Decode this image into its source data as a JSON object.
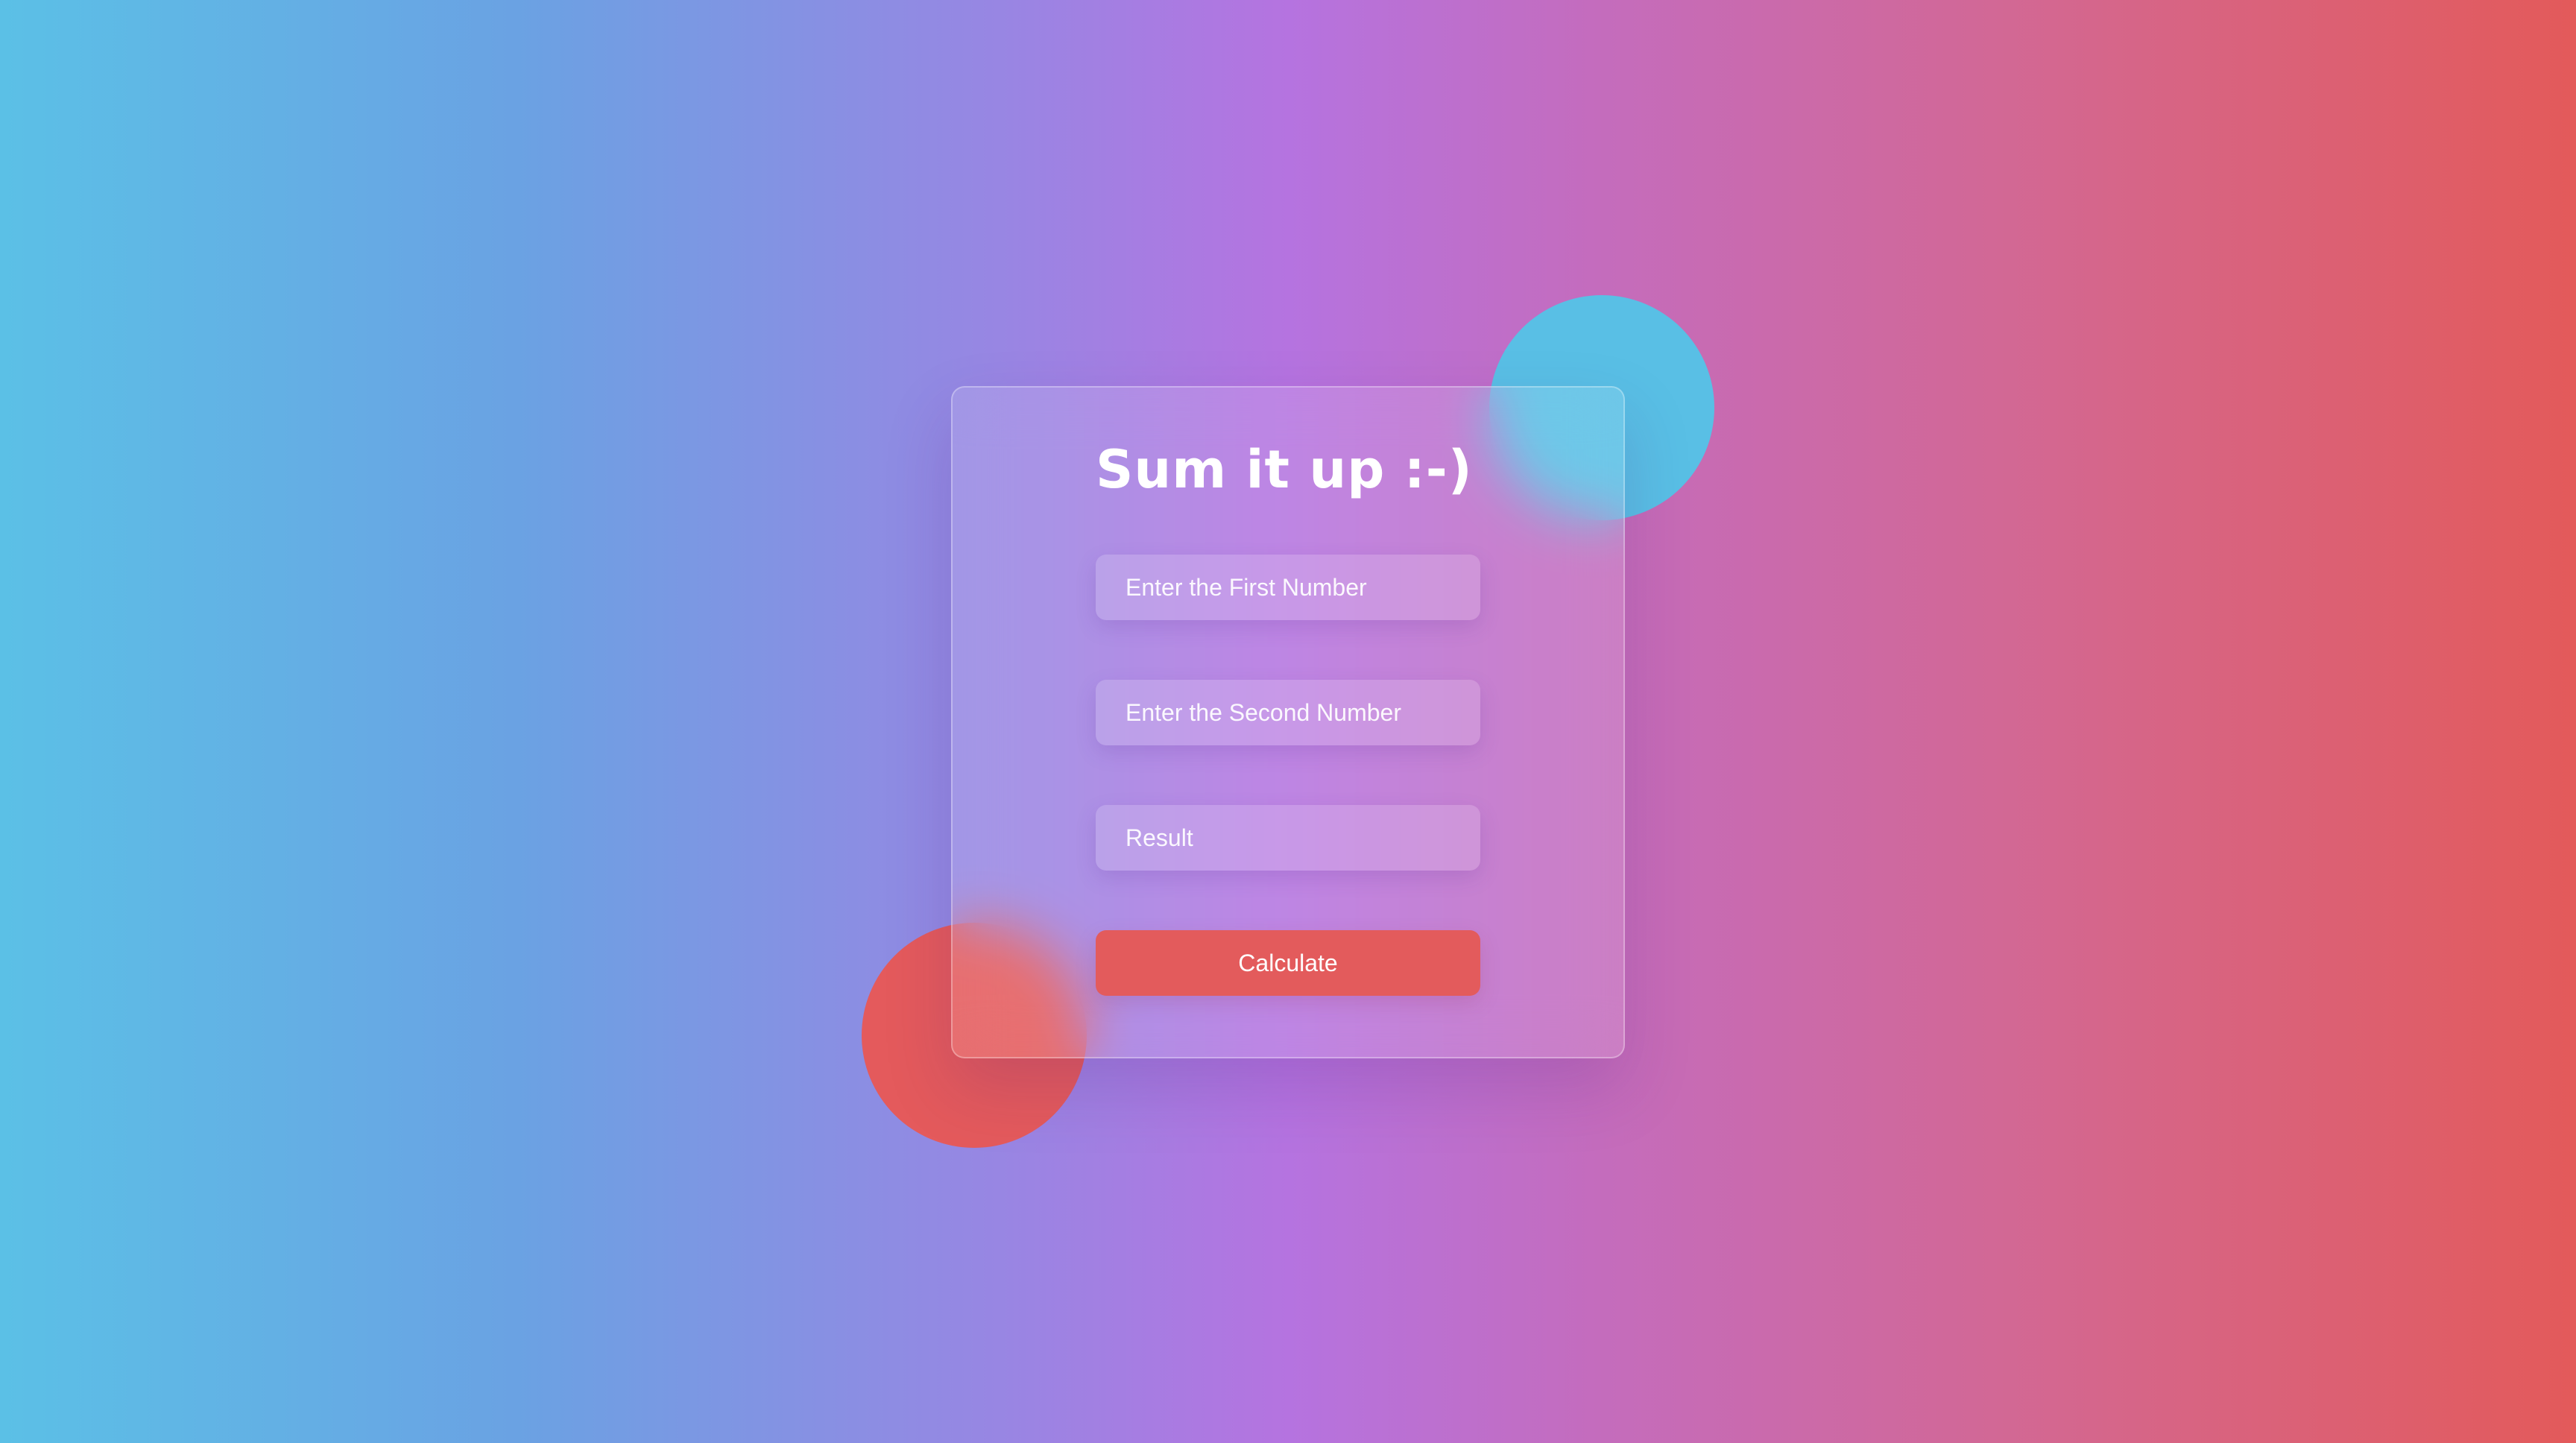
{
  "app": {
    "title": "Sum it up :-)"
  },
  "form": {
    "first_number": {
      "placeholder": "Enter the First Number",
      "value": ""
    },
    "second_number": {
      "placeholder": "Enter the Second Number",
      "value": ""
    },
    "result": {
      "placeholder": "Result",
      "value": ""
    },
    "calculate_label": "Calculate"
  },
  "colors": {
    "gradient_left": "#5bc0e6",
    "gradient_middle": "#b573e0",
    "gradient_right": "#e35a5a",
    "accent_circle_blue": "#59bfe5",
    "accent_circle_red": "#e45a5c",
    "button": "#e35b5c"
  }
}
